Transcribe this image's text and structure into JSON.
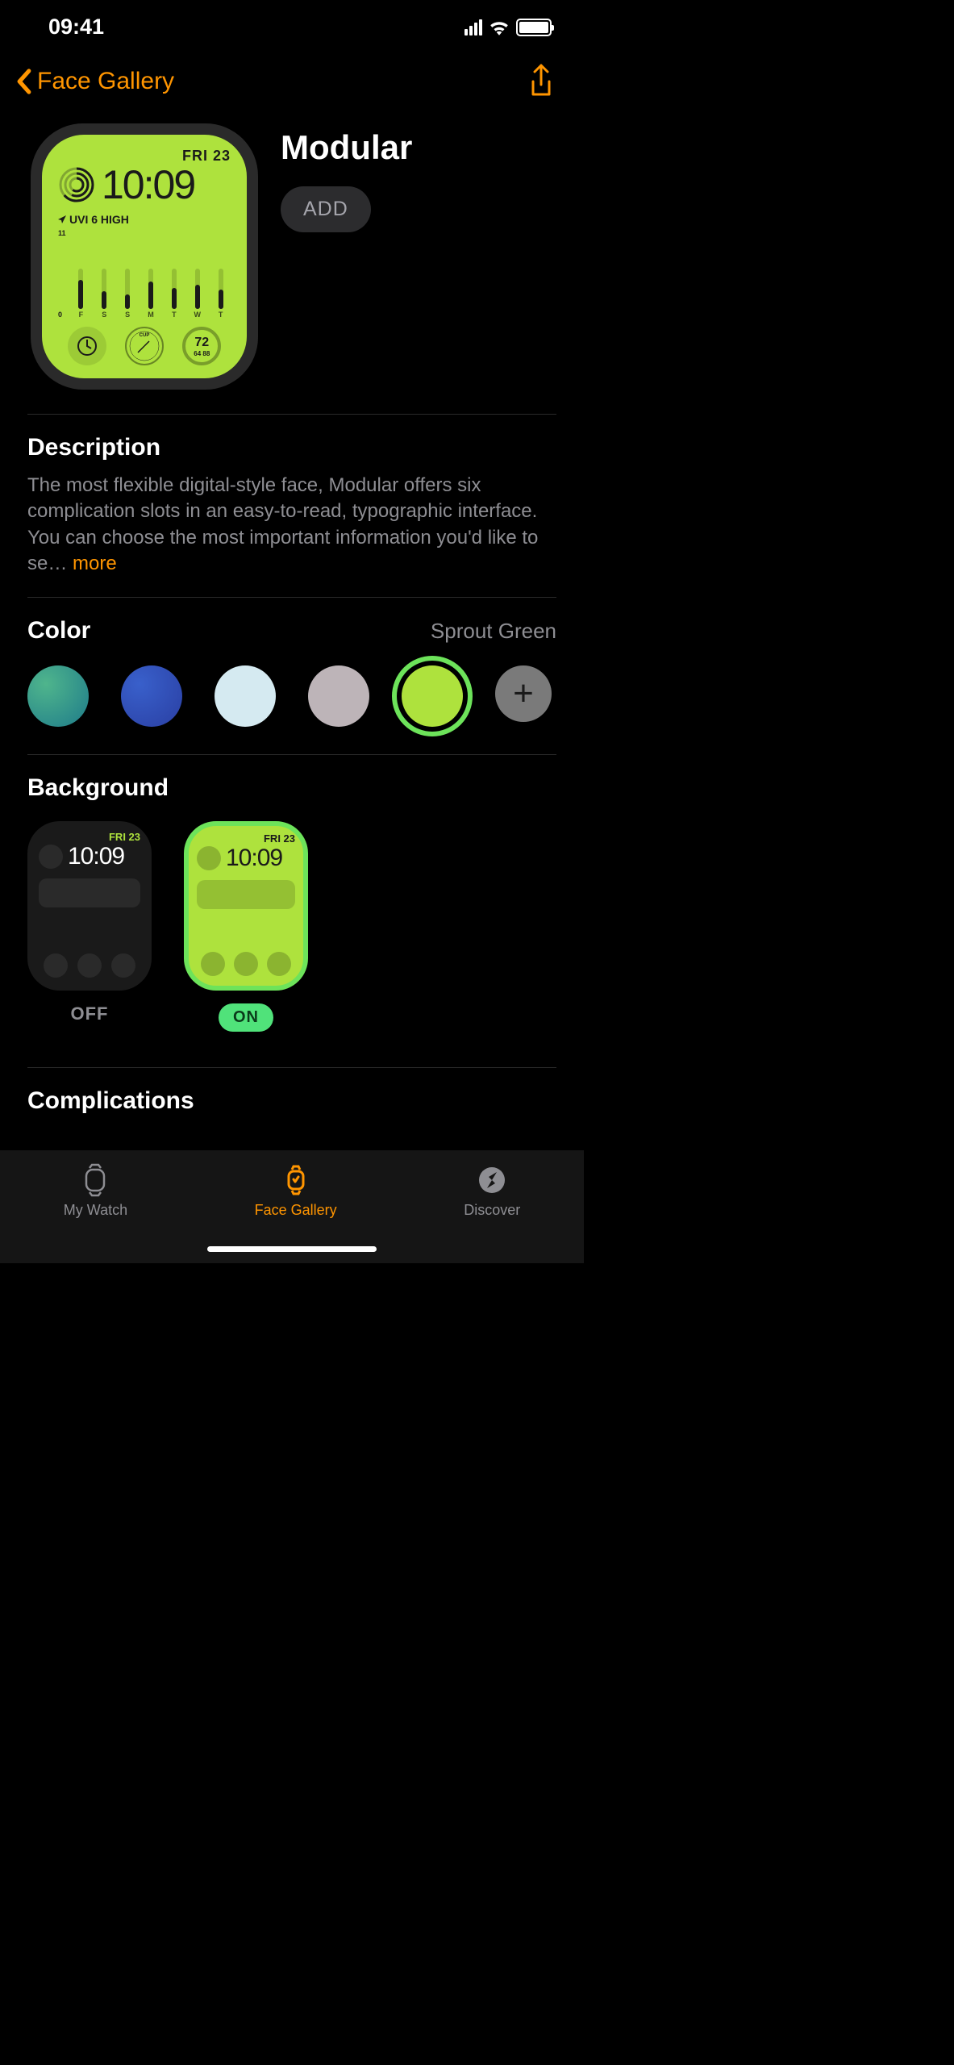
{
  "status_bar": {
    "time": "09:41"
  },
  "nav": {
    "back_label": "Face Gallery"
  },
  "hero": {
    "title": "Modular",
    "add_label": "ADD",
    "watch": {
      "date": "FRI 23",
      "time": "10:09",
      "uvi_text": "UVI 6 HIGH",
      "chart_y_max": "11",
      "chart_y_min": "0",
      "chart_days": [
        "F",
        "S",
        "S",
        "M",
        "T",
        "W",
        "T"
      ],
      "temp_main": "72",
      "temp_range": "64  88",
      "dial_label": "CUP"
    }
  },
  "description": {
    "heading": "Description",
    "text": "The most flexible digital-style face, Modular offers six complication slots in an easy-to-read, typographic interface. You can choose the most important information you'd like to se…",
    "more_label": "more"
  },
  "color": {
    "heading": "Color",
    "selected_name": "Sprout Green",
    "swatches": [
      {
        "name": "teal-gradient",
        "bg": "radial-gradient(circle at 30% 30%, #4fb58c, #1e7b8a)"
      },
      {
        "name": "blue",
        "bg": "radial-gradient(circle at 30% 30%, #3960cb, #2a3fa3)"
      },
      {
        "name": "pale-blue",
        "bg": "#d5eaf1"
      },
      {
        "name": "grey",
        "bg": "#bdb4b8"
      },
      {
        "name": "sprout-green",
        "bg": "#aee23d",
        "selected": true,
        "ring": "#6de35a"
      }
    ]
  },
  "background": {
    "heading": "Background",
    "options": {
      "off_label": "OFF",
      "on_label": "ON",
      "date": "FRI 23",
      "time": "10:09"
    }
  },
  "complications": {
    "heading": "Complications"
  },
  "tabs": {
    "my_watch": "My Watch",
    "face_gallery": "Face Gallery",
    "discover": "Discover"
  }
}
